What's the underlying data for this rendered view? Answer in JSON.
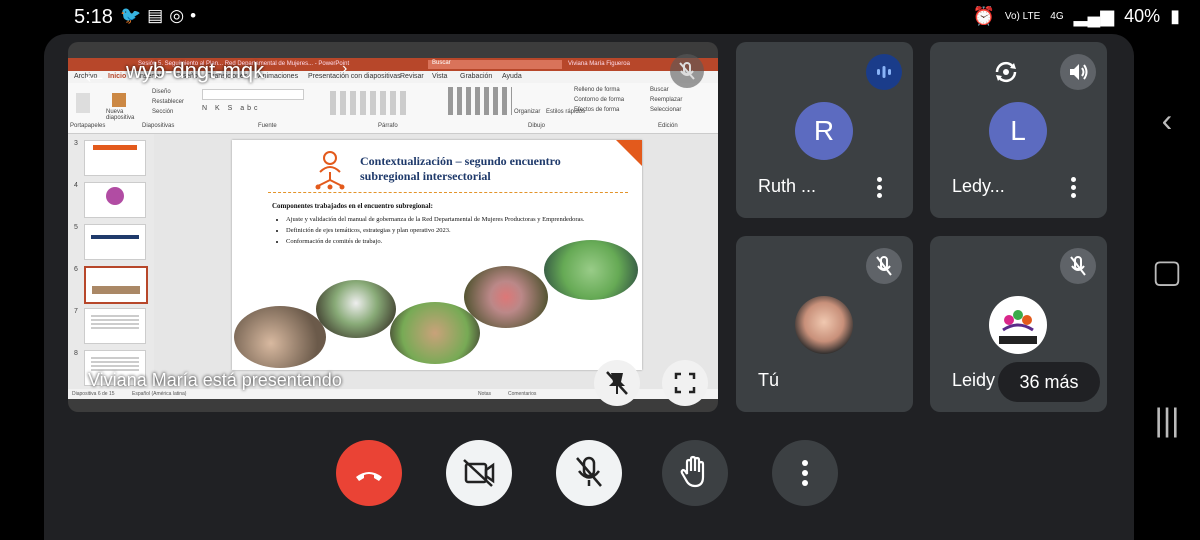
{
  "status_bar": {
    "time": "5:18",
    "left_icons": [
      "twitter-icon",
      "news-icon",
      "instagram-icon",
      "dot-icon"
    ],
    "network": "Vo) LTE",
    "network_type": "4G",
    "battery": "40%"
  },
  "meeting": {
    "code": "wyb-dngt-mqk",
    "presenter_label": "Viviana María está presentando"
  },
  "slide_app": {
    "title_text": "Sesión 5. Seguimiento al Plan... Red Departamental de Mujeres... - PowerPoint",
    "search_placeholder": "Buscar",
    "user_name": "Viviana María Figueroa",
    "tabs": [
      "Archivo",
      "Inicio",
      "Insertar",
      "Diseño",
      "Transiciones",
      "Animaciones",
      "Presentación con diapositivas",
      "Revisar",
      "Vista",
      "Grabación",
      "Ayuda"
    ],
    "ribbon_groups": [
      "Portapapeles",
      "Diapositivas",
      "Fuente",
      "Párrafo",
      "Dibujo",
      "Edición"
    ],
    "ribbon_items": {
      "nueva": "Nueva diapositiva",
      "diseno": "Diseño",
      "restablecer": "Restablecer",
      "seccion": "Sección",
      "organizar": "Organizar",
      "estilos": "Estilos rápidos",
      "relleno": "Relleno de forma",
      "contorno": "Contorno de forma",
      "efectos": "Efectos de forma",
      "buscar": "Buscar",
      "reemplazar": "Reemplazar",
      "seleccionar": "Seleccionar"
    },
    "thumb_numbers": [
      "3",
      "4",
      "5",
      "6",
      "7",
      "8"
    ],
    "slide_title": "Contextualización – segundo encuentro subregional intersectorial",
    "slide_subtitle": "Componentes trabajados en el encuentro subregional:",
    "slide_bullets": [
      "Ajuste y validación del manual de gobernanza de la Red Departamental de Mujeres Productoras y Emprendedoras.",
      "Definición de ejes temáticos, estrategias y plan operativo 2023.",
      "Conformación de comités de trabajo."
    ],
    "status_slide": "Diapositiva 6 de 15",
    "status_lang": "Español (América latina)",
    "status_notes": "Notas",
    "status_comments": "Comentarios"
  },
  "participants": [
    {
      "initial": "R",
      "name": "Ruth ...",
      "avatar_color": "#5c6bc0"
    },
    {
      "initial": "L",
      "name": "Ledy...",
      "avatar_color": "#5c6bc0"
    },
    {
      "name": "Tú"
    },
    {
      "name": "Leidy Asisten",
      "logo_text": "CORPORACIÓN PRODEPAZ"
    }
  ],
  "more_count": "36 más",
  "colors": {
    "end_call": "#ea4335",
    "tile_bg": "#3c4043",
    "app_bg": "#202124",
    "speaking": "#1a73e8"
  }
}
